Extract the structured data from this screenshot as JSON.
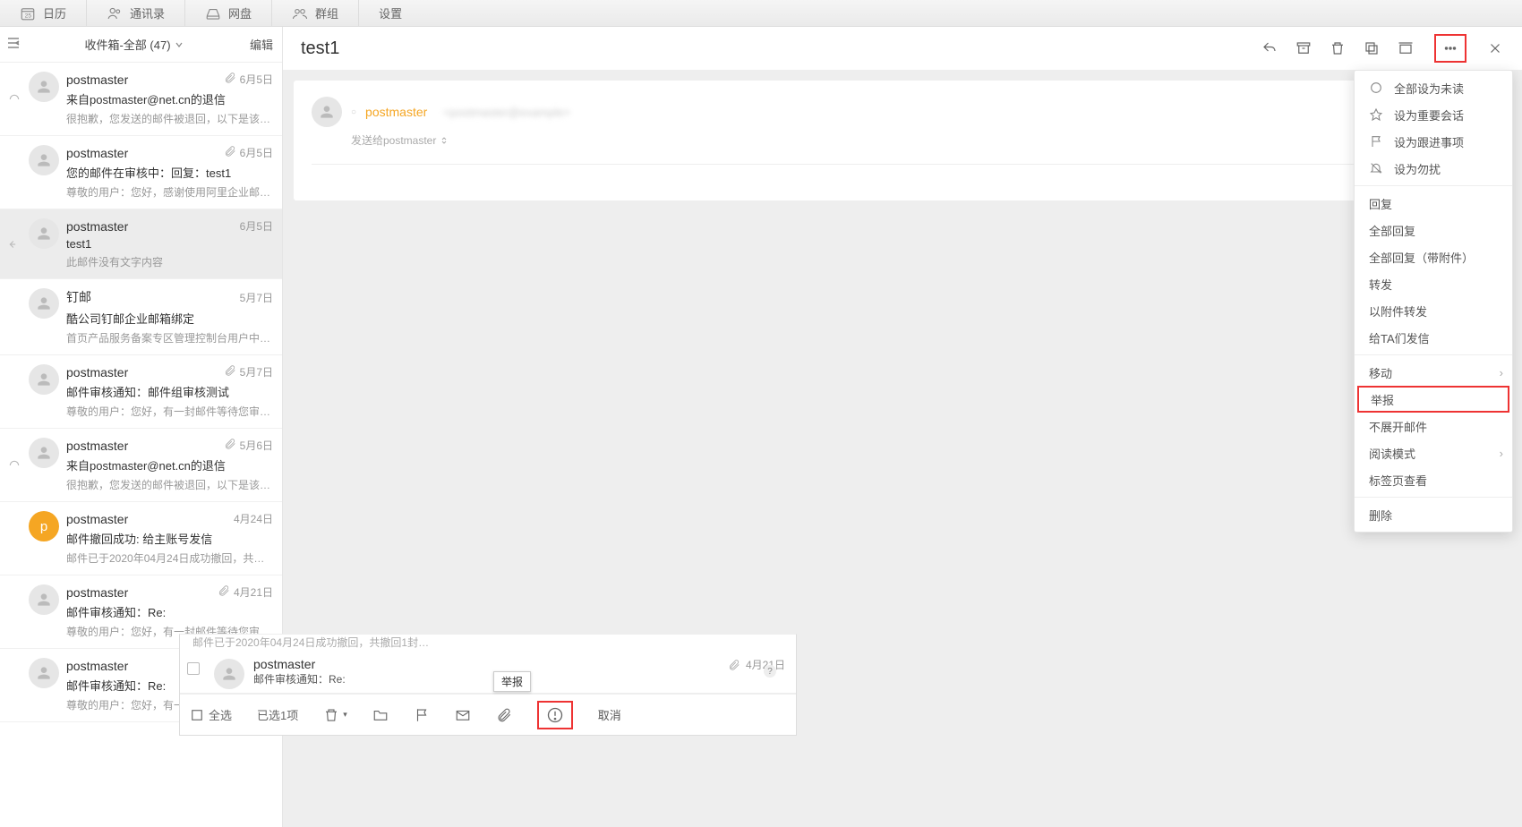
{
  "topnav": {
    "calendar": "日历",
    "calendar_badge": "25",
    "contacts": "通讯录",
    "disk": "网盘",
    "groups": "群组",
    "settings": "设置"
  },
  "list_header": {
    "title": "收件箱-全部 (47)",
    "edit": "编辑"
  },
  "mails": [
    {
      "sender": "postmaster",
      "date": "6月5日",
      "subject": "来自postmaster@net.cn的退信",
      "preview": "很抱歉，您发送的邮件被退回，以下是该邮件的…",
      "attach": true,
      "lefticon": "arc"
    },
    {
      "sender": "postmaster",
      "date": "6月5日",
      "subject": "您的邮件在审核中：回复：test1",
      "preview": "尊敬的用户：您好，感谢使用阿里企业邮箱。实…",
      "attach": true,
      "lefticon": null
    },
    {
      "sender": "postmaster",
      "date": "6月5日",
      "subject": "test1",
      "preview": "此邮件没有文字内容",
      "attach": false,
      "lefticon": "reply",
      "selected": true
    },
    {
      "sender": "钉邮",
      "date": "5月7日",
      "subject": "酷公司钉邮企业邮箱绑定",
      "preview": "首页产品服务备案专区管理控制台用户中心帮助…",
      "attach": false,
      "lefticon": null
    },
    {
      "sender": "postmaster",
      "date": "5月7日",
      "subject": "邮件审核通知：邮件组审核测试",
      "preview": "尊敬的用户：您好，有一封邮件等待您审核。",
      "attach": true,
      "lefticon": null
    },
    {
      "sender": "postmaster",
      "date": "5月6日",
      "subject": "来自postmaster@net.cn的退信",
      "preview": "很抱歉，您发送的邮件被退回，以下是该邮件的…",
      "attach": true,
      "lefticon": "arc"
    },
    {
      "sender": "postmaster",
      "date": "4月24日",
      "subject": "邮件撤回成功: 给主账号发信",
      "preview": "邮件已于2020年04月24日成功撤回，共撤回1封…",
      "attach": false,
      "lefticon": null,
      "avatar": "p"
    },
    {
      "sender": "postmaster",
      "date": "4月21日",
      "subject": "邮件审核通知：Re:",
      "preview": "尊敬的用户：您好，有一封邮件等待您审核。",
      "attach": true,
      "lefticon": null
    },
    {
      "sender": "postmaster",
      "date": "4月21日",
      "subject": "邮件审核通知：Re:",
      "preview": "尊敬的用户：您好，有一封邮件等待您审核。",
      "attach": true,
      "lefticon": null
    }
  ],
  "reader": {
    "subject": "test1",
    "from_name": "postmaster",
    "recipients_label": "发送给postmaster"
  },
  "menu": {
    "mark_unread": "全部设为未读",
    "mark_important": "设为重要会话",
    "mark_followup": "设为跟进事项",
    "mark_dnd": "设为勿扰",
    "reply": "回复",
    "reply_all": "全部回复",
    "reply_all_attach": "全部回复（带附件）",
    "forward": "转发",
    "forward_attach": "以附件转发",
    "write_to": "给TA们发信",
    "move": "移动",
    "report": "举报",
    "no_expand": "不展开邮件",
    "read_mode": "阅读模式",
    "open_tab": "标签页查看",
    "delete": "删除"
  },
  "float": {
    "truncated_preview": "邮件已于2020年04月24日成功撤回，共撤回1封…",
    "sender": "postmaster",
    "subject": "邮件审核通知：Re:",
    "date": "4月21日",
    "count_badge": "?",
    "select_all": "全选",
    "selected": "已选1项",
    "report_tooltip": "举报",
    "cancel": "取消"
  }
}
